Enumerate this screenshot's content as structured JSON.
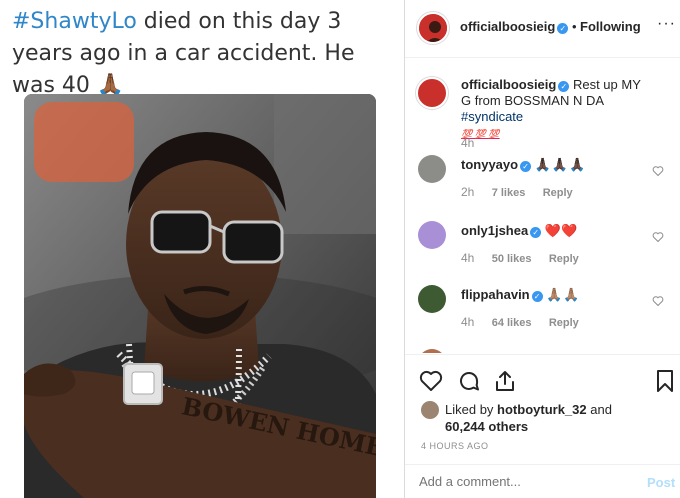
{
  "tweet": {
    "hashtag": "#ShawtyLo",
    "caption_rest": " died on this day 3 years ago in a car accident. He was 40 🙏🏾",
    "tattoo_text": "BOWEN HOMES"
  },
  "post": {
    "username": "officialboosieig",
    "dot": "•",
    "follow_label": "Following",
    "more": "···"
  },
  "comments": [
    {
      "username": "officialboosieig",
      "text": "Rest up MY G from BOSSMAN N DA",
      "tag": "#syndicate",
      "emoji": "💯 💯 💯",
      "time": "4h"
    },
    {
      "username": "tonyyayo",
      "text": "🙏🏿🙏🏿🙏🏿",
      "time": "2h",
      "likes": "7 likes",
      "reply": "Reply"
    },
    {
      "username": "only1jshea",
      "text": "❤️❤️",
      "time": "4h",
      "likes": "50 likes",
      "reply": "Reply"
    },
    {
      "username": "flippahavin",
      "text": "🙏🏽🙏🏽",
      "time": "4h",
      "likes": "64 likes",
      "reply": "Reply"
    }
  ],
  "likes": {
    "prefix": "Liked by ",
    "user": "hotboyturk_32",
    "and": " and",
    "count": "60,244 others"
  },
  "time_ago": "4 HOURS AGO",
  "add_comment": {
    "placeholder": "Add a comment...",
    "post_label": "Post"
  },
  "colors": {
    "hashtag": "#2f86c9",
    "verified": "#3897f0",
    "post_disabled": "#b2dffc"
  }
}
